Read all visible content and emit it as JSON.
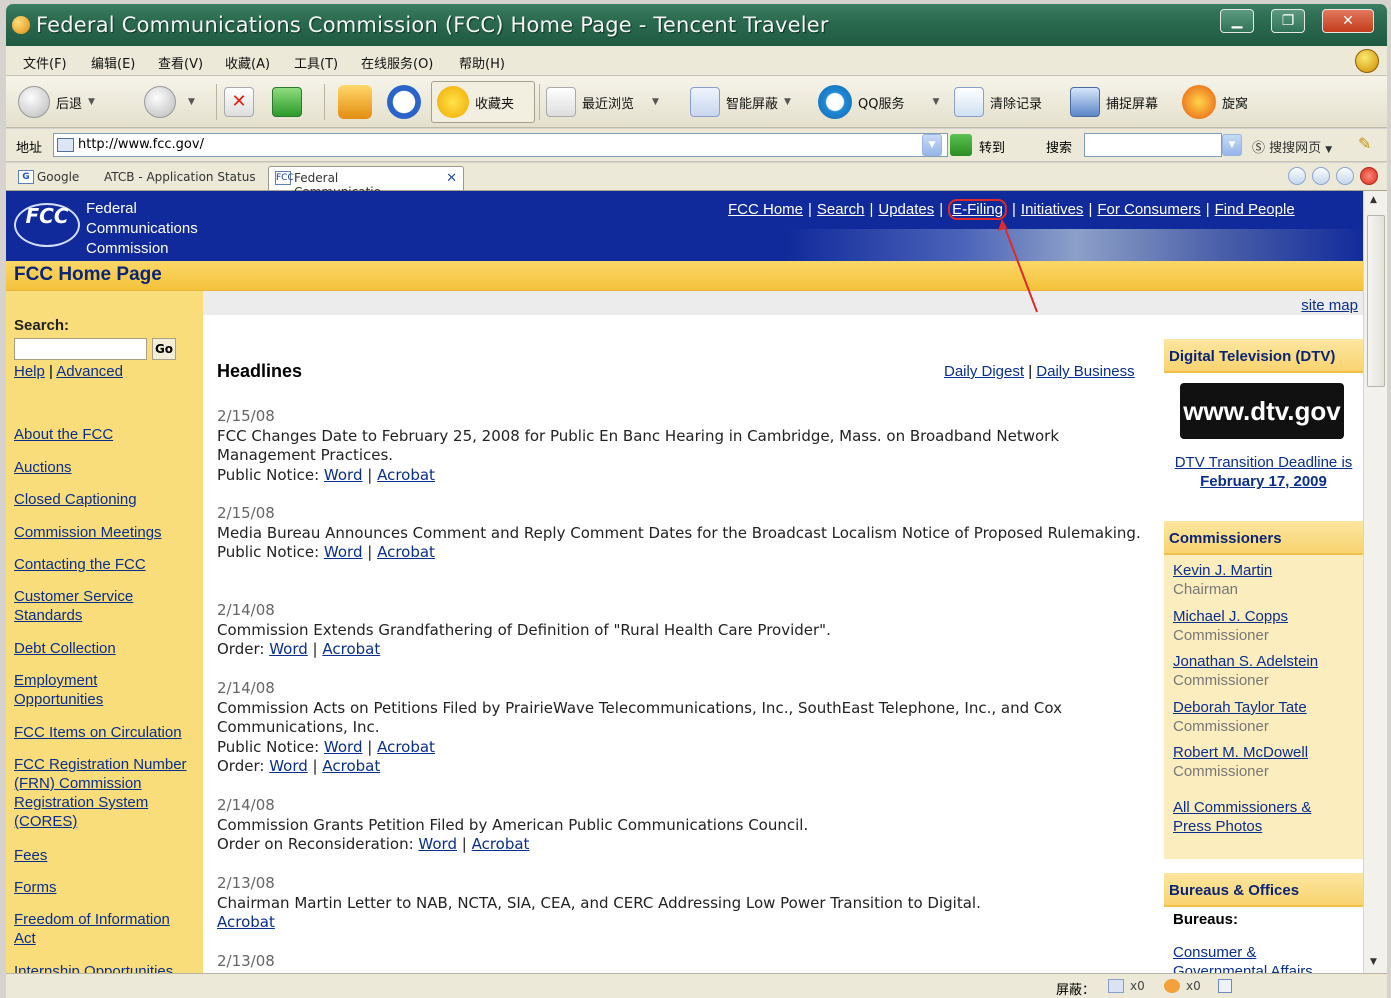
{
  "window": {
    "title": "Federal Communications Commission (FCC) Home Page - Tencent Traveler"
  },
  "menu": [
    "文件(F)",
    "编辑(E)",
    "查看(V)",
    "收藏(A)",
    "工具(T)",
    "在线服务(O)",
    "帮助(H)"
  ],
  "toolbar": {
    "back": "后退",
    "favorites": "收藏夹",
    "recent": "最近浏览",
    "smart_block": "智能屏蔽",
    "qq_service": "QQ服务",
    "clear_history": "清除记录",
    "capture_screen": "捕捉屏幕",
    "xuanwo": "旋窝"
  },
  "address": {
    "label": "地址",
    "url": "http://www.fcc.gov/",
    "go": "转到",
    "search_label": "搜索",
    "search_engine": "搜搜网页"
  },
  "tabs": [
    {
      "label": "Google"
    },
    {
      "label": "ATCB - Application Status"
    },
    {
      "label": "Federal Communicatio..."
    }
  ],
  "fcc": {
    "logo": "FCC",
    "name_line1": "Federal",
    "name_line2": "Communications",
    "name_line3": "Commission",
    "nav": [
      "FCC Home",
      "Search",
      "Updates",
      "E-Filing",
      "Initiatives",
      "For Consumers",
      "Find People"
    ],
    "page_title": "FCC Home Page",
    "site_map": "site map"
  },
  "left": {
    "search_label": "Search:",
    "go": "Go",
    "help": "Help",
    "advanced": "Advanced",
    "links": [
      "About the FCC",
      "Auctions",
      "Closed Captioning",
      "Commission Meetings",
      "Contacting the FCC",
      "Customer Service Standards",
      "Debt Collection",
      "Employment Opportunities",
      "FCC Items on Circulation",
      "FCC Registration Number (FRN) Commission Registration System (CORES)",
      "Fees",
      "Forms",
      "Freedom of Information Act",
      "Internship Opportunities"
    ]
  },
  "headlines": {
    "title": "Headlines",
    "daily_digest": "Daily Digest",
    "daily_business": "Daily Business",
    "items": [
      {
        "date": "2/15/08",
        "text": "FCC Changes Date to February 25, 2008 for Public En Banc Hearing in Cambridge, Mass. on Broadband Network Management Practices.",
        "doc1": "Public Notice:",
        "doc1_links": [
          "Word",
          "Acrobat"
        ]
      },
      {
        "date": "2/15/08",
        "text": "Media Bureau Announces Comment and Reply Comment Dates for the Broadcast Localism Notice of Proposed Rulemaking.",
        "doc1": "Public Notice:",
        "doc1_links": [
          "Word",
          "Acrobat"
        ]
      },
      {
        "date": "2/14/08",
        "text": "Commission Extends Grandfathering of Definition of \"Rural Health Care Provider\".",
        "doc1": "Order:",
        "doc1_links": [
          "Word",
          "Acrobat"
        ]
      },
      {
        "date": "2/14/08",
        "text": "Commission Acts on Petitions Filed by PrairieWave Telecommunications, Inc., SouthEast Telephone, Inc., and Cox Communications, Inc.",
        "doc1": "Public Notice:",
        "doc1_links": [
          "Word",
          "Acrobat"
        ],
        "doc2": "Order:",
        "doc2_links": [
          "Word",
          "Acrobat"
        ]
      },
      {
        "date": "2/14/08",
        "text": "Commission Grants Petition Filed by American Public Communications Council.",
        "doc1": "Order on Reconsideration:",
        "doc1_links": [
          "Word",
          "Acrobat"
        ]
      },
      {
        "date": "2/13/08",
        "text": "Chairman Martin Letter to NAB, NCTA, SIA, CEA, and CERC Addressing Low Power Transition to Digital.",
        "doc1": "",
        "doc1_links": [
          "Acrobat"
        ]
      },
      {
        "date": "2/13/08"
      }
    ]
  },
  "right": {
    "dtv_title": "Digital Television (DTV)",
    "dtv_logo": "www.dtv.gov",
    "dtv_link_line1": "DTV Transition Deadline is",
    "dtv_link_line2": "February 17, 2009",
    "commissioners_title": "Commissioners",
    "commissioners": [
      {
        "name": "Kevin J. Martin",
        "role": "Chairman"
      },
      {
        "name": "Michael J. Copps",
        "role": "Commissioner"
      },
      {
        "name": "Jonathan S. Adelstein",
        "role": "Commissioner"
      },
      {
        "name": "Deborah Taylor Tate",
        "role": "Commissioner"
      },
      {
        "name": "Robert M. McDowell",
        "role": "Commissioner"
      }
    ],
    "all_commissioners_line1": "All Commissioners &",
    "all_commissioners_line2": "Press Photos",
    "bureaus_title": "Bureaus & Offices",
    "bureaus_label": "Bureaus:",
    "bureau1_line1": "Consumer &",
    "bureau1_line2": "Governmental Affairs"
  },
  "status": {
    "block_label": "屏蔽：",
    "count1": "x0",
    "count2": "x0"
  }
}
